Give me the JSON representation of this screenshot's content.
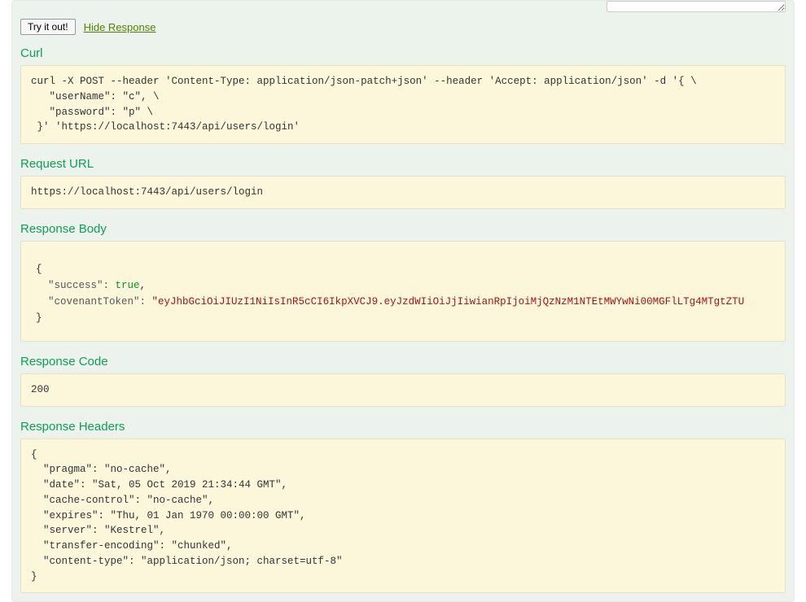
{
  "toolbar": {
    "try_label": "Try it out!",
    "hide_label": "Hide Response"
  },
  "sections": {
    "curl": {
      "title": "Curl",
      "content": "curl -X POST --header 'Content-Type: application/json-patch+json' --header 'Accept: application/json' -d '{ \\\n   \"userName\": \"c\", \\\n   \"password\": \"p\" \\\n }' 'https://localhost:7443/api/users/login'"
    },
    "request_url": {
      "title": "Request URL",
      "content": "https://localhost:7443/api/users/login"
    },
    "response_body": {
      "title": "Response Body",
      "json": {
        "success": true,
        "covenantToken": "eyJhbGciOiJIUzI1NiIsInR5cCI6IkpXVCJ9.eyJzdWIiOiJjIiwianRpIjoiMjQzNzM1NTEtMWYwNi00MGFlLTg4MTgtZTU"
      },
      "open_brace": "{",
      "key1": "  \"success\": ",
      "val1_true": "true",
      "comma1": ",",
      "key2": "  \"covenantToken\": ",
      "val2": "\"eyJhbGciOiJIUzI1NiIsInR5cCI6IkpXVCJ9.eyJzdWIiOiJjIiwianRpIjoiMjQzNzM1NTEtMWYwNi00MGFlLTg4MTgtZTU",
      "close_brace": "}"
    },
    "response_code": {
      "title": "Response Code",
      "content": "200"
    },
    "response_headers": {
      "title": "Response Headers",
      "content": "{\n  \"pragma\": \"no-cache\",\n  \"date\": \"Sat, 05 Oct 2019 21:34:44 GMT\",\n  \"cache-control\": \"no-cache\",\n  \"expires\": \"Thu, 01 Jan 1970 00:00:00 GMT\",\n  \"server\": \"Kestrel\",\n  \"transfer-encoding\": \"chunked\",\n  \"content-type\": \"application/json; charset=utf-8\"\n}"
    }
  }
}
